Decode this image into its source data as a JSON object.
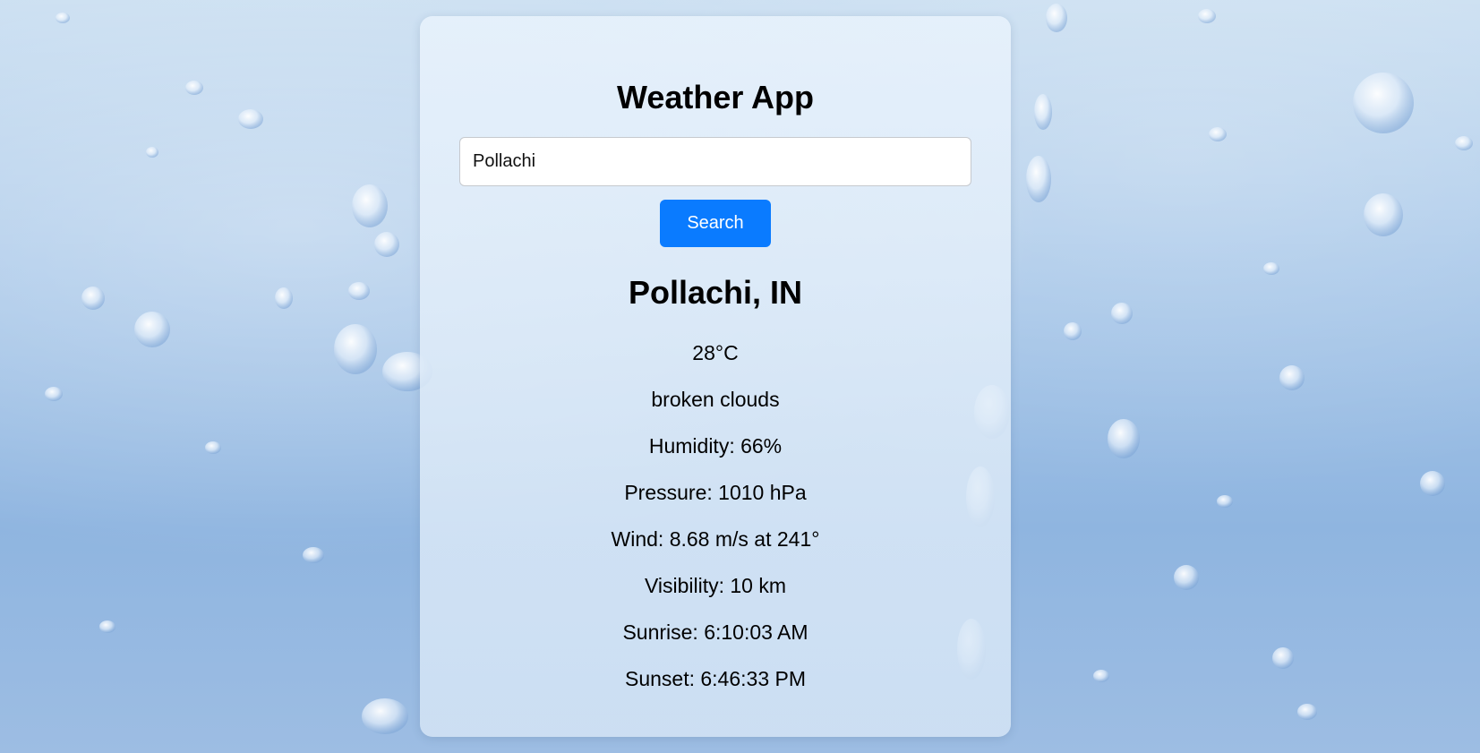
{
  "app": {
    "title": "Weather App"
  },
  "search": {
    "value": "Pollachi",
    "button_label": "Search"
  },
  "weather": {
    "location": "Pollachi, IN",
    "temperature": "28°C",
    "description": "broken clouds",
    "humidity": "Humidity: 66%",
    "pressure": "Pressure: 1010 hPa",
    "wind": "Wind: 8.68 m/s at 241°",
    "visibility": "Visibility: 10 km",
    "sunrise": "Sunrise: 6:10:03 AM",
    "sunset": "Sunset: 6:46:33 PM"
  },
  "colors": {
    "accent": "#0a7bff",
    "background": "#a9c8e9"
  }
}
